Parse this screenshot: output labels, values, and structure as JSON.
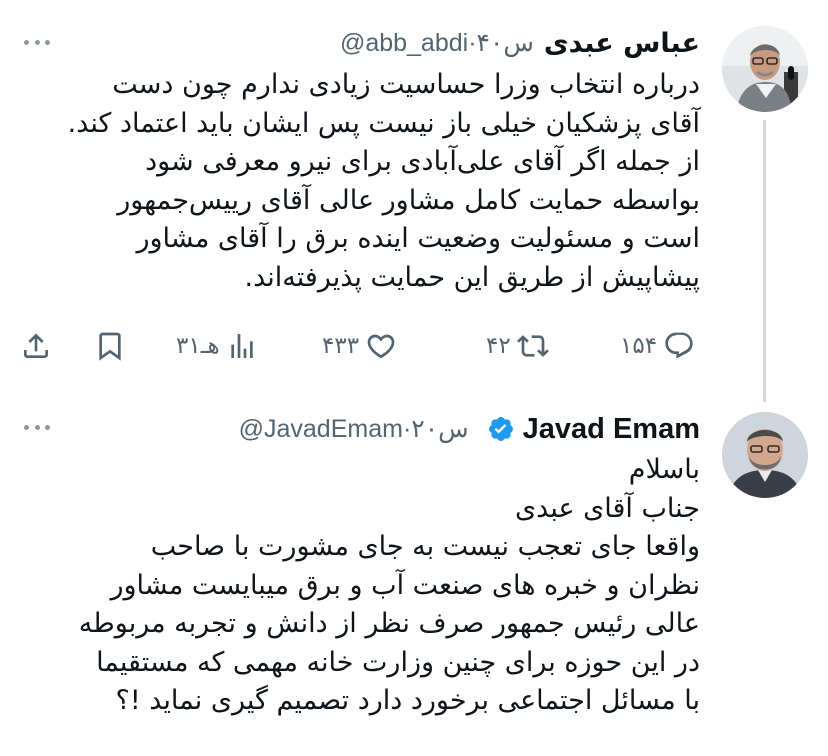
{
  "tweets": [
    {
      "author_name": "عباس عبدی",
      "handle": "@abb_abdi",
      "time": "۴۰س",
      "text_lines": [
        "درباره انتخاب وزرا حساسیت زیادی ندارم چون دست",
        "آقای پزشکیان خیلی باز نیست پس ایشان باید اعتماد کند.",
        "از جمله اگر آقای علی‌آبادی برای نیرو معرفی شود",
        "بواسطه حمایت کامل مشاور عالی آقای رییس‌جمهور",
        "است و مسئولیت وضعیت اینده برق را آقای مشاور",
        "پیشاپیش از طریق این حمایت پذیرفته‌اند."
      ],
      "actions": {
        "replies": "۱۵۴",
        "retweets": "۴۲",
        "likes": "۴۳۳",
        "views": "۳۱هـ"
      }
    },
    {
      "author_name": "Javad Emam",
      "handle": "@JavadEmam",
      "time": "۲۰س",
      "verified": true,
      "text_lines": [
        "باسلام",
        "جناب آقای عبدی",
        "واقعا جای تعجب نیست به جای مشورت با صاحب",
        "نظران و خبره های صنعت آب و برق میبایست مشاور",
        "عالی رئیس جمهور صرف نظر از دانش و تجربه مربوطه",
        "در این حوزه برای چنین وزارت خانه مهمی که مستقیما",
        "با مسائل اجتماعی برخورد دارد تصمیم گیری نماید !؟"
      ]
    }
  ],
  "icons": {
    "more": "more-dots-icon",
    "reply": "reply-icon",
    "retweet": "retweet-icon",
    "like": "like-icon",
    "views": "views-icon",
    "bookmark": "bookmark-icon",
    "share": "share-icon",
    "verified": "verified-badge-icon"
  },
  "colors": {
    "text": "#0f1419",
    "secondary": "#536471",
    "verified": "#1d9bf0",
    "thread_line": "#cfd9de"
  }
}
